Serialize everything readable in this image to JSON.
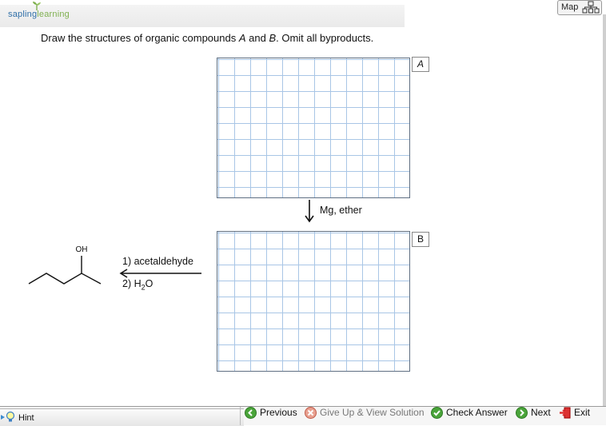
{
  "brand": {
    "part1": "sapling",
    "part2": "learning"
  },
  "map_button": {
    "label": "Map"
  },
  "question": {
    "pre": "Draw the structures of organic compounds ",
    "a": "A",
    "mid": " and ",
    "b": "B",
    "post": ". Omit all byproducts."
  },
  "boxes": {
    "a_label": "A",
    "b_label": "B"
  },
  "reagents": {
    "step1": "Mg, ether",
    "step2_line1": "1) acetaldehyde",
    "step2_line2_pre": "2) H",
    "step2_line2_sub": "2",
    "step2_line2_post": "O"
  },
  "molecule": {
    "oh_label": "OH"
  },
  "footer": {
    "hint": "Hint",
    "previous": "Previous",
    "give_up": "Give Up & View Solution",
    "check": "Check Answer",
    "next": "Next",
    "exit": "Exit"
  },
  "colors": {
    "grid_line": "#a9c6e6",
    "brand_blue": "#2f6fa8",
    "brand_green": "#7fb050"
  }
}
